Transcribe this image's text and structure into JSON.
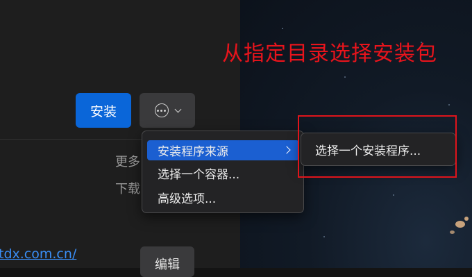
{
  "toolbar": {
    "install_label": "安装",
    "more_icon": "ellipsis-circle-icon",
    "chevron_icon": "chevron-down-icon"
  },
  "details": {
    "more_text": "更多",
    "download_text": "下载",
    "website_link": "tdx.com.cn/",
    "edit_label": "编辑"
  },
  "menu": {
    "items": [
      {
        "label": "安装程序来源",
        "active": true,
        "has_submenu": true
      },
      {
        "label": "选择一个容器...",
        "active": false,
        "has_submenu": false
      },
      {
        "label": "高级选项...",
        "active": false,
        "has_submenu": false
      }
    ]
  },
  "submenu": {
    "items": [
      {
        "label": "选择一个安装程序..."
      }
    ]
  },
  "annotation": {
    "text": "从指定目录选择安装包",
    "color": "#e8141c"
  },
  "colors": {
    "accent": "#0a66d9",
    "menu_highlight": "#1b5fd1",
    "link": "#3a8ef6"
  }
}
